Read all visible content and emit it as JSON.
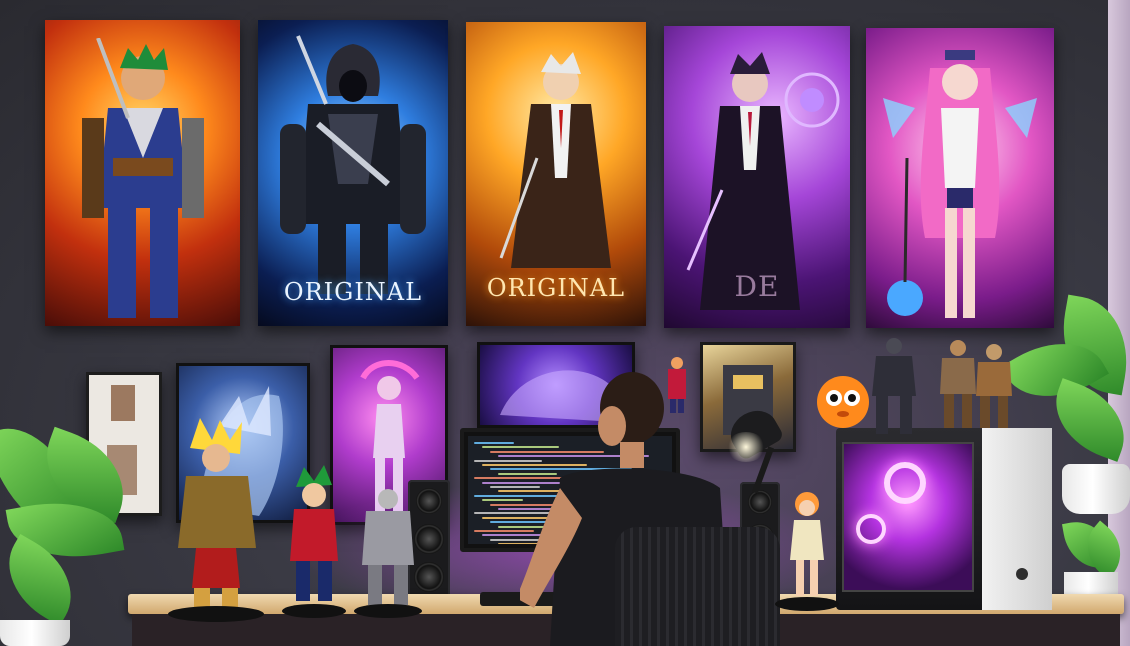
{
  "scene": {
    "poster_titles": [
      "ORIGINAL",
      "ORIGINAL",
      "DE"
    ],
    "colors": {
      "wall": "#3a3a44",
      "desk_top": "#e4c28c",
      "rgb_accent": "#d050ff",
      "plant_green": "#3f9a32"
    }
  }
}
